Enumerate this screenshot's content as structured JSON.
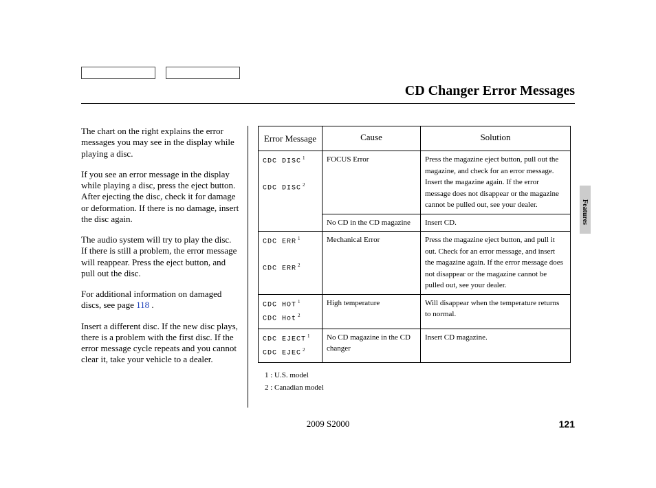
{
  "header": {
    "title": "CD Changer Error Messages"
  },
  "body": {
    "p1": "The chart on the right explains the error messages you may see in the display while playing a disc.",
    "p2": "If you see an error message in the display while playing a disc, press the eject button. After ejecting the disc, check it for damage or deformation. If there is no damage, insert the disc again.",
    "p3": "The audio system will try to play the disc. If there is still a problem, the error message will reappear. Press the eject button, and pull out the disc.",
    "p4a": "For additional information on damaged discs, see page ",
    "p4_page": "118",
    "p4b": " .",
    "p5": "Insert a different disc. If the new disc plays, there is a problem with the first disc. If the error message cycle repeats and you cannot clear it, take your vehicle to a dealer."
  },
  "table": {
    "headers": {
      "error": "Error Message",
      "cause": "Cause",
      "solution": "Solution"
    },
    "rows": [
      {
        "disp1": "CDC  DISC",
        "sup1": "1",
        "disp2": "CDC DISC",
        "sup2": "2",
        "cause": "FOCUS Error",
        "solution": "Press the magazine eject button, pull out the magazine, and check for an error message. Insert the magazine again. If the error message does not disappear or the magazine cannot be pulled out, see your dealer."
      },
      {
        "disp1": "",
        "sup1": "",
        "disp2": "",
        "sup2": "",
        "cause": "No CD in the CD magazine",
        "solution": "Insert CD."
      },
      {
        "disp1": "CDC   ERR",
        "sup1": "1",
        "disp2": "CDC ERR",
        "sup2": "2",
        "cause": "Mechanical Error",
        "solution": "Press the magazine eject button, and pull it out. Check for an error message, and insert the magazine again. If the error message does not disappear or the magazine cannot be pulled out, see your dealer."
      },
      {
        "disp1": "CDC   HOT",
        "sup1": "1",
        "disp2": "CDC Hot",
        "sup2": "2",
        "cause": "High temperature",
        "solution": "Will disappear when the temperature returns to normal."
      },
      {
        "disp1": "CDC  EJECT",
        "sup1": "1",
        "disp2": "CDC EJEC",
        "sup2": "2",
        "cause": "No CD magazine in the CD changer",
        "solution": "Insert CD magazine."
      }
    ]
  },
  "notes": {
    "n1": "1 : U.S. model",
    "n2": "2 : Canadian model"
  },
  "side_tab": "Features",
  "footer": {
    "model": "2009  S2000",
    "page": "121"
  }
}
